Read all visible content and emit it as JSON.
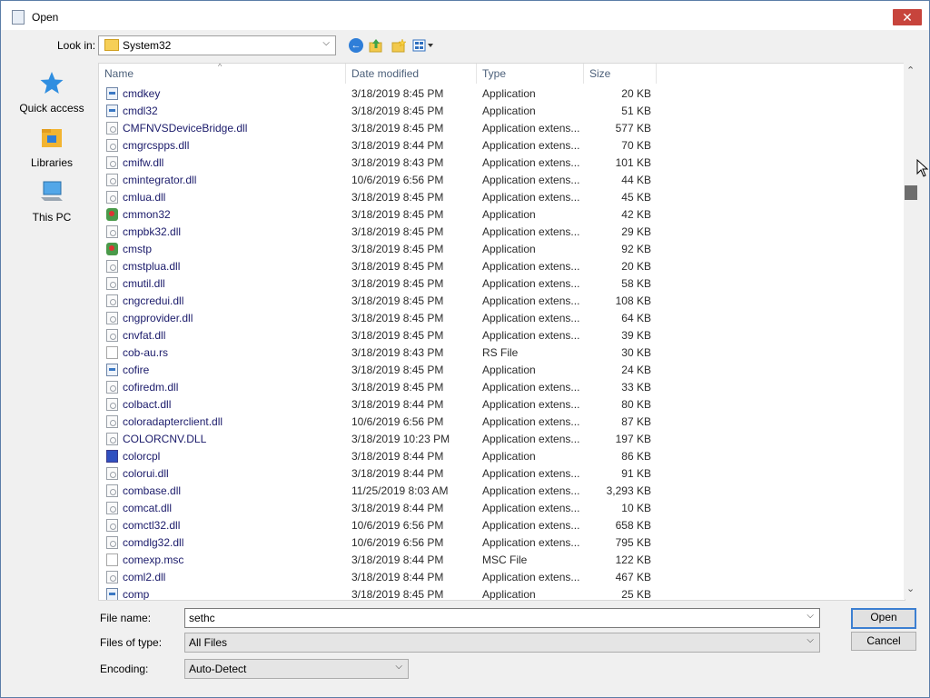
{
  "window": {
    "title": "Open",
    "close_glyph": "✕"
  },
  "toolbar": {
    "look_in_label": "Look in:",
    "look_in_value": "System32",
    "icons": [
      "back-icon",
      "up-folder-icon",
      "new-folder-icon",
      "views-menu-icon"
    ]
  },
  "places": [
    {
      "label": "Quick access",
      "icon": "star-icon"
    },
    {
      "label": "Libraries",
      "icon": "libraries-icon"
    },
    {
      "label": "This PC",
      "icon": "computer-icon"
    }
  ],
  "columns": {
    "name": "Name",
    "date": "Date modified",
    "type": "Type",
    "size": "Size"
  },
  "files": [
    {
      "name": "cmdkey",
      "date": "3/18/2019 8:45 PM",
      "type": "Application",
      "size": "20 KB",
      "icon": "app"
    },
    {
      "name": "cmdl32",
      "date": "3/18/2019 8:45 PM",
      "type": "Application",
      "size": "51 KB",
      "icon": "app"
    },
    {
      "name": "CMFNVSDeviceBridge.dll",
      "date": "3/18/2019 8:45 PM",
      "type": "Application extens...",
      "size": "577 KB",
      "icon": "dll"
    },
    {
      "name": "cmgrcspps.dll",
      "date": "3/18/2019 8:44 PM",
      "type": "Application extens...",
      "size": "70 KB",
      "icon": "dll"
    },
    {
      "name": "cmifw.dll",
      "date": "3/18/2019 8:43 PM",
      "type": "Application extens...",
      "size": "101 KB",
      "icon": "dll"
    },
    {
      "name": "cmintegrator.dll",
      "date": "10/6/2019 6:56 PM",
      "type": "Application extens...",
      "size": "44 KB",
      "icon": "dll"
    },
    {
      "name": "cmlua.dll",
      "date": "3/18/2019 8:45 PM",
      "type": "Application extens...",
      "size": "45 KB",
      "icon": "dll"
    },
    {
      "name": "cmmon32",
      "date": "3/18/2019 8:45 PM",
      "type": "Application",
      "size": "42 KB",
      "icon": "special"
    },
    {
      "name": "cmpbk32.dll",
      "date": "3/18/2019 8:45 PM",
      "type": "Application extens...",
      "size": "29 KB",
      "icon": "dll"
    },
    {
      "name": "cmstp",
      "date": "3/18/2019 8:45 PM",
      "type": "Application",
      "size": "92 KB",
      "icon": "special"
    },
    {
      "name": "cmstplua.dll",
      "date": "3/18/2019 8:45 PM",
      "type": "Application extens...",
      "size": "20 KB",
      "icon": "dll"
    },
    {
      "name": "cmutil.dll",
      "date": "3/18/2019 8:45 PM",
      "type": "Application extens...",
      "size": "58 KB",
      "icon": "dll"
    },
    {
      "name": "cngcredui.dll",
      "date": "3/18/2019 8:45 PM",
      "type": "Application extens...",
      "size": "108 KB",
      "icon": "dll"
    },
    {
      "name": "cngprovider.dll",
      "date": "3/18/2019 8:45 PM",
      "type": "Application extens...",
      "size": "64 KB",
      "icon": "dll"
    },
    {
      "name": "cnvfat.dll",
      "date": "3/18/2019 8:45 PM",
      "type": "Application extens...",
      "size": "39 KB",
      "icon": "dll"
    },
    {
      "name": "cob-au.rs",
      "date": "3/18/2019 8:43 PM",
      "type": "RS File",
      "size": "30 KB",
      "icon": "file"
    },
    {
      "name": "cofire",
      "date": "3/18/2019 8:45 PM",
      "type": "Application",
      "size": "24 KB",
      "icon": "app"
    },
    {
      "name": "cofiredm.dll",
      "date": "3/18/2019 8:45 PM",
      "type": "Application extens...",
      "size": "33 KB",
      "icon": "dll"
    },
    {
      "name": "colbact.dll",
      "date": "3/18/2019 8:44 PM",
      "type": "Application extens...",
      "size": "80 KB",
      "icon": "dll"
    },
    {
      "name": "coloradapterclient.dll",
      "date": "10/6/2019 6:56 PM",
      "type": "Application extens...",
      "size": "87 KB",
      "icon": "dll"
    },
    {
      "name": "COLORCNV.DLL",
      "date": "3/18/2019 10:23 PM",
      "type": "Application extens...",
      "size": "197 KB",
      "icon": "dll"
    },
    {
      "name": "colorcpl",
      "date": "3/18/2019 8:44 PM",
      "type": "Application",
      "size": "86 KB",
      "icon": "monitor"
    },
    {
      "name": "colorui.dll",
      "date": "3/18/2019 8:44 PM",
      "type": "Application extens...",
      "size": "91 KB",
      "icon": "dll"
    },
    {
      "name": "combase.dll",
      "date": "11/25/2019 8:03 AM",
      "type": "Application extens...",
      "size": "3,293 KB",
      "icon": "dll"
    },
    {
      "name": "comcat.dll",
      "date": "3/18/2019 8:44 PM",
      "type": "Application extens...",
      "size": "10 KB",
      "icon": "dll"
    },
    {
      "name": "comctl32.dll",
      "date": "10/6/2019 6:56 PM",
      "type": "Application extens...",
      "size": "658 KB",
      "icon": "dll"
    },
    {
      "name": "comdlg32.dll",
      "date": "10/6/2019 6:56 PM",
      "type": "Application extens...",
      "size": "795 KB",
      "icon": "dll"
    },
    {
      "name": "comexp.msc",
      "date": "3/18/2019 8:44 PM",
      "type": "MSC File",
      "size": "122 KB",
      "icon": "file"
    },
    {
      "name": "coml2.dll",
      "date": "3/18/2019 8:44 PM",
      "type": "Application extens...",
      "size": "467 KB",
      "icon": "dll"
    },
    {
      "name": "comp",
      "date": "3/18/2019 8:45 PM",
      "type": "Application",
      "size": "25 KB",
      "icon": "app"
    }
  ],
  "form": {
    "file_name_label": "File name:",
    "file_name_value": "sethc",
    "files_of_type_label": "Files of type:",
    "files_of_type_value": "All Files",
    "encoding_label": "Encoding:",
    "encoding_value": "Auto-Detect"
  },
  "buttons": {
    "open": "Open",
    "cancel": "Cancel"
  },
  "glyphs": {
    "chevron_down": "⌵",
    "scroll_up": "⌃",
    "scroll_down": "⌄",
    "back": "←",
    "sort": "^"
  }
}
